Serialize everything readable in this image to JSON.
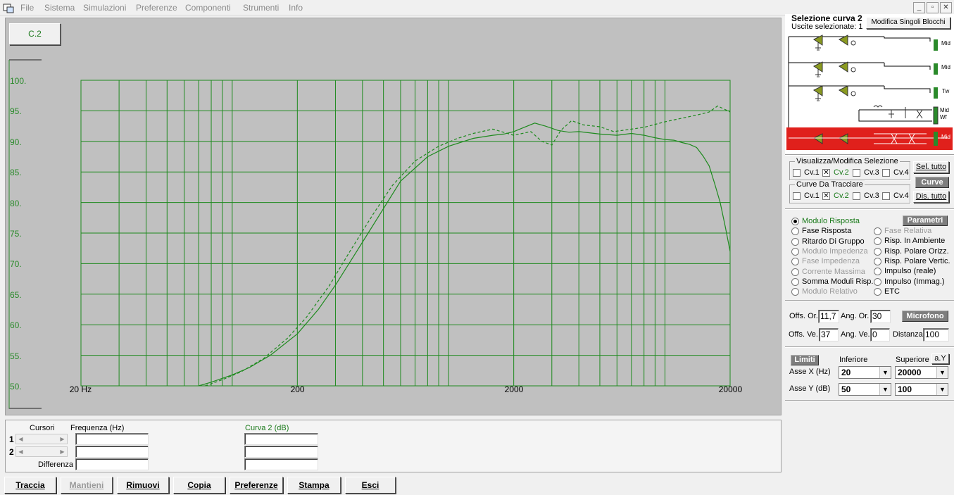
{
  "menu": [
    "File",
    "Sistema",
    "Simulazioni",
    "Preferenze",
    "Componenti",
    "Strumenti",
    "Info"
  ],
  "window_buttons": [
    "_",
    "▫",
    "✕"
  ],
  "curve_tag": "C.2",
  "chart_data": {
    "type": "line",
    "xscale": "log",
    "xlim": [
      20,
      20000
    ],
    "ylim": [
      50,
      100
    ],
    "y_ticks": [
      "100.",
      "95.",
      "90.",
      "85.",
      "80.",
      "75.",
      "70.",
      "65.",
      "60.",
      "55.",
      "50."
    ],
    "x_ticks": [
      "20 Hz",
      "200",
      "2000",
      "20000"
    ],
    "series": [
      {
        "style": "solid",
        "color": "#1e8a1e",
        "x": [
          70,
          80,
          100,
          120,
          150,
          200,
          250,
          300,
          400,
          500,
          600,
          800,
          1000,
          1300,
          1600,
          1800,
          2000,
          2200,
          2500,
          2800,
          3200,
          3600,
          4000,
          5000,
          6000,
          7000,
          8000,
          9000,
          10000,
          11000,
          12000,
          13000,
          14000,
          15000,
          16000,
          17000,
          18000,
          19000,
          20000
        ],
        "y": [
          50.0,
          50.6,
          51.8,
          53.0,
          55.0,
          58.5,
          62.5,
          66.5,
          73.5,
          79.0,
          83.5,
          87.5,
          89.2,
          90.5,
          91.0,
          91.2,
          91.6,
          92.2,
          93.0,
          92.5,
          91.8,
          91.5,
          91.6,
          91.2,
          91.0,
          91.3,
          91.0,
          90.6,
          90.3,
          90.2,
          89.8,
          89.5,
          89.0,
          87.6,
          86.0,
          83.0,
          80.0,
          76.0,
          72.0
        ]
      },
      {
        "style": "dashed",
        "color": "#1e8a1e",
        "x": [
          75,
          90,
          110,
          140,
          180,
          220,
          280,
          350,
          450,
          550,
          700,
          900,
          1100,
          1300,
          1600,
          2000,
          2400,
          2700,
          3000,
          3300,
          3700,
          4200,
          5000,
          5800,
          7000,
          8000,
          10000,
          12000,
          14000,
          16000,
          17500,
          19000,
          20000
        ],
        "y": [
          50.0,
          51.0,
          52.3,
          54.5,
          57.8,
          61.2,
          66.3,
          72.0,
          78.2,
          82.8,
          86.8,
          89.2,
          90.5,
          91.3,
          92.0,
          91.0,
          91.6,
          90.0,
          89.4,
          91.8,
          93.4,
          92.7,
          92.4,
          91.6,
          92.0,
          92.3,
          93.2,
          93.8,
          94.3,
          94.8,
          95.8,
          95.2,
          94.8
        ]
      }
    ]
  },
  "selection": {
    "title": "Selezione curva 2",
    "outputs_label": "Uscite selezionate: 1",
    "modify_button": "Modifica Singoli Blocchi",
    "driver_labels": [
      "Mid",
      "Mid",
      "Tw",
      "Mid",
      "Wf",
      "Mid"
    ]
  },
  "view_group": {
    "title": "Visualizza/Modifica Selezione",
    "items": [
      {
        "label": "Cv.1",
        "checked": false
      },
      {
        "label": "Cv.2",
        "checked": true
      },
      {
        "label": "Cv.3",
        "checked": false
      },
      {
        "label": "Cv.4",
        "checked": false
      }
    ],
    "select_all": "Sel. tutto"
  },
  "curves_button": "Curve",
  "plot_group": {
    "title": "Curve Da Tracciare",
    "items": [
      {
        "label": "Cv.1",
        "checked": false
      },
      {
        "label": "Cv.2",
        "checked": true
      },
      {
        "label": "Cv.3",
        "checked": false
      },
      {
        "label": "Cv.4",
        "checked": false
      }
    ],
    "deselect_all": "Dis. tutto"
  },
  "params_button": "Parametri",
  "radios_left": [
    {
      "label": "Modulo Risposta",
      "selected": true,
      "state": "active"
    },
    {
      "label": "Fase Risposta",
      "selected": false,
      "state": "normal"
    },
    {
      "label": "Ritardo Di Gruppo",
      "selected": false,
      "state": "normal"
    },
    {
      "label": "Modulo Impedenza",
      "selected": false,
      "state": "disabled"
    },
    {
      "label": "Fase Impedenza",
      "selected": false,
      "state": "disabled"
    },
    {
      "label": "Corrente Massima",
      "selected": false,
      "state": "disabled"
    },
    {
      "label": "Somma Moduli Risp.",
      "selected": false,
      "state": "normal"
    },
    {
      "label": "Modulo Relativo",
      "selected": false,
      "state": "disabled"
    }
  ],
  "radios_right": [
    {
      "label": "Fase Relativa",
      "selected": false,
      "state": "disabled"
    },
    {
      "label": "Risp. In Ambiente",
      "selected": false,
      "state": "normal"
    },
    {
      "label": "Risp. Polare Orizz.",
      "selected": false,
      "state": "normal"
    },
    {
      "label": "Risp. Polare Vertic.",
      "selected": false,
      "state": "normal"
    },
    {
      "label": "Impulso (reale)",
      "selected": false,
      "state": "normal"
    },
    {
      "label": "Impulso (Immag.)",
      "selected": false,
      "state": "normal"
    },
    {
      "label": "ETC",
      "selected": false,
      "state": "normal"
    }
  ],
  "mic": {
    "offs_or_label": "Offs. Or.",
    "offs_or": "11,7",
    "ang_or_label": "Ang. Or.",
    "ang_or": "30",
    "button": "Microfono",
    "offs_ve_label": "Offs. Ve.",
    "offs_ve": "37",
    "ang_ve_label": "Ang. Ve.",
    "ang_ve": "0",
    "dist_label": "Distanza",
    "dist": "100"
  },
  "limits": {
    "button": "Limiti",
    "lower_label": "Inferiore",
    "upper_label": "Superiore",
    "auto_y": "a.Y",
    "x_label": "Asse X  (Hz)",
    "x_min": "20",
    "x_max": "20000",
    "y_label": "Asse Y  (dB)",
    "y_min": "50",
    "y_max": "100"
  },
  "cursors": {
    "label": "Cursori",
    "freq_label": "Frequenza (Hz)",
    "curve_label": "Curva 2 (dB)",
    "row1": "1",
    "row2": "2",
    "diff_label": "Differenza"
  },
  "bottom_buttons": [
    {
      "label": "Traccia",
      "enabled": true
    },
    {
      "label": "Mantieni",
      "enabled": false
    },
    {
      "label": "Rimuovi",
      "enabled": true
    },
    {
      "label": "Copia",
      "enabled": true
    },
    {
      "label": "Preferenze",
      "enabled": true
    },
    {
      "label": "Stampa",
      "enabled": true
    },
    {
      "label": "Esci",
      "enabled": true
    }
  ]
}
